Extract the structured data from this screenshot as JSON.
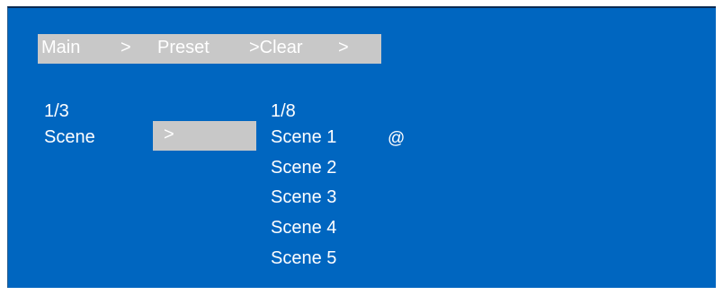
{
  "breadcrumb": {
    "main": "Main",
    "sep1": ">",
    "preset": "Preset",
    "clear": ">Clear",
    "sep3": ">"
  },
  "left_menu": {
    "page_indicator": "1/3",
    "item_label": "Scene",
    "arrow": ">"
  },
  "right_menu": {
    "page_indicator": "1/8",
    "items": [
      "Scene 1",
      "Scene 2",
      "Scene 3",
      "Scene 4",
      "Scene 5"
    ],
    "active_marker": "@"
  },
  "colors": {
    "background": "#0066c0",
    "highlight": "#c8c8c8",
    "text": "#ffffff"
  }
}
